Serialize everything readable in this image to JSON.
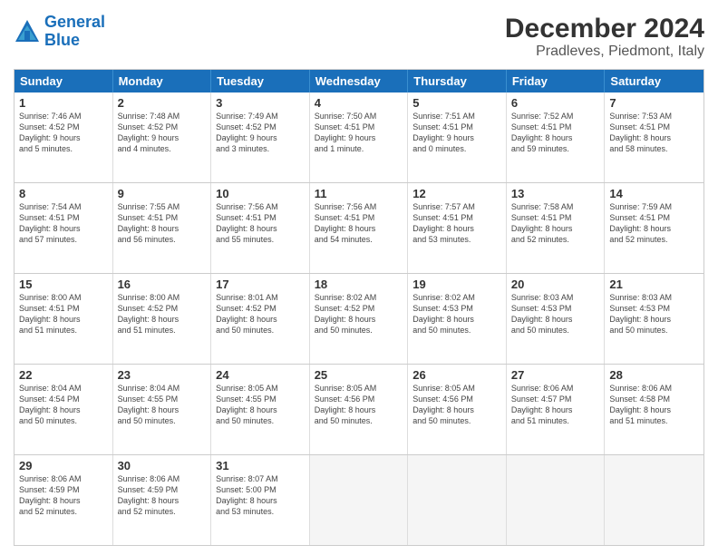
{
  "header": {
    "logo_line1": "General",
    "logo_line2": "Blue",
    "title": "December 2024",
    "subtitle": "Pradleves, Piedmont, Italy"
  },
  "calendar": {
    "weekdays": [
      "Sunday",
      "Monday",
      "Tuesday",
      "Wednesday",
      "Thursday",
      "Friday",
      "Saturday"
    ],
    "weeks": [
      [
        {
          "num": "",
          "info": ""
        },
        {
          "num": "2",
          "info": "Sunrise: 7:48 AM\nSunset: 4:52 PM\nDaylight: 9 hours\nand 4 minutes."
        },
        {
          "num": "3",
          "info": "Sunrise: 7:49 AM\nSunset: 4:52 PM\nDaylight: 9 hours\nand 3 minutes."
        },
        {
          "num": "4",
          "info": "Sunrise: 7:50 AM\nSunset: 4:51 PM\nDaylight: 9 hours\nand 1 minute."
        },
        {
          "num": "5",
          "info": "Sunrise: 7:51 AM\nSunset: 4:51 PM\nDaylight: 9 hours\nand 0 minutes."
        },
        {
          "num": "6",
          "info": "Sunrise: 7:52 AM\nSunset: 4:51 PM\nDaylight: 8 hours\nand 59 minutes."
        },
        {
          "num": "7",
          "info": "Sunrise: 7:53 AM\nSunset: 4:51 PM\nDaylight: 8 hours\nand 58 minutes."
        }
      ],
      [
        {
          "num": "1",
          "info": "Sunrise: 7:46 AM\nSunset: 4:52 PM\nDaylight: 9 hours\nand 5 minutes."
        },
        {
          "num": "",
          "info": ""
        },
        {
          "num": "",
          "info": ""
        },
        {
          "num": "",
          "info": ""
        },
        {
          "num": "",
          "info": ""
        },
        {
          "num": "",
          "info": ""
        },
        {
          "num": "",
          "info": ""
        }
      ],
      [
        {
          "num": "8",
          "info": "Sunrise: 7:54 AM\nSunset: 4:51 PM\nDaylight: 8 hours\nand 57 minutes."
        },
        {
          "num": "9",
          "info": "Sunrise: 7:55 AM\nSunset: 4:51 PM\nDaylight: 8 hours\nand 56 minutes."
        },
        {
          "num": "10",
          "info": "Sunrise: 7:56 AM\nSunset: 4:51 PM\nDaylight: 8 hours\nand 55 minutes."
        },
        {
          "num": "11",
          "info": "Sunrise: 7:56 AM\nSunset: 4:51 PM\nDaylight: 8 hours\nand 54 minutes."
        },
        {
          "num": "12",
          "info": "Sunrise: 7:57 AM\nSunset: 4:51 PM\nDaylight: 8 hours\nand 53 minutes."
        },
        {
          "num": "13",
          "info": "Sunrise: 7:58 AM\nSunset: 4:51 PM\nDaylight: 8 hours\nand 52 minutes."
        },
        {
          "num": "14",
          "info": "Sunrise: 7:59 AM\nSunset: 4:51 PM\nDaylight: 8 hours\nand 52 minutes."
        }
      ],
      [
        {
          "num": "15",
          "info": "Sunrise: 8:00 AM\nSunset: 4:51 PM\nDaylight: 8 hours\nand 51 minutes."
        },
        {
          "num": "16",
          "info": "Sunrise: 8:00 AM\nSunset: 4:52 PM\nDaylight: 8 hours\nand 51 minutes."
        },
        {
          "num": "17",
          "info": "Sunrise: 8:01 AM\nSunset: 4:52 PM\nDaylight: 8 hours\nand 50 minutes."
        },
        {
          "num": "18",
          "info": "Sunrise: 8:02 AM\nSunset: 4:52 PM\nDaylight: 8 hours\nand 50 minutes."
        },
        {
          "num": "19",
          "info": "Sunrise: 8:02 AM\nSunset: 4:53 PM\nDaylight: 8 hours\nand 50 minutes."
        },
        {
          "num": "20",
          "info": "Sunrise: 8:03 AM\nSunset: 4:53 PM\nDaylight: 8 hours\nand 50 minutes."
        },
        {
          "num": "21",
          "info": "Sunrise: 8:03 AM\nSunset: 4:53 PM\nDaylight: 8 hours\nand 50 minutes."
        }
      ],
      [
        {
          "num": "22",
          "info": "Sunrise: 8:04 AM\nSunset: 4:54 PM\nDaylight: 8 hours\nand 50 minutes."
        },
        {
          "num": "23",
          "info": "Sunrise: 8:04 AM\nSunset: 4:55 PM\nDaylight: 8 hours\nand 50 minutes."
        },
        {
          "num": "24",
          "info": "Sunrise: 8:05 AM\nSunset: 4:55 PM\nDaylight: 8 hours\nand 50 minutes."
        },
        {
          "num": "25",
          "info": "Sunrise: 8:05 AM\nSunset: 4:56 PM\nDaylight: 8 hours\nand 50 minutes."
        },
        {
          "num": "26",
          "info": "Sunrise: 8:05 AM\nSunset: 4:56 PM\nDaylight: 8 hours\nand 50 minutes."
        },
        {
          "num": "27",
          "info": "Sunrise: 8:06 AM\nSunset: 4:57 PM\nDaylight: 8 hours\nand 51 minutes."
        },
        {
          "num": "28",
          "info": "Sunrise: 8:06 AM\nSunset: 4:58 PM\nDaylight: 8 hours\nand 51 minutes."
        }
      ],
      [
        {
          "num": "29",
          "info": "Sunrise: 8:06 AM\nSunset: 4:59 PM\nDaylight: 8 hours\nand 52 minutes."
        },
        {
          "num": "30",
          "info": "Sunrise: 8:06 AM\nSunset: 4:59 PM\nDaylight: 8 hours\nand 52 minutes."
        },
        {
          "num": "31",
          "info": "Sunrise: 8:07 AM\nSunset: 5:00 PM\nDaylight: 8 hours\nand 53 minutes."
        },
        {
          "num": "",
          "info": ""
        },
        {
          "num": "",
          "info": ""
        },
        {
          "num": "",
          "info": ""
        },
        {
          "num": "",
          "info": ""
        }
      ]
    ]
  }
}
